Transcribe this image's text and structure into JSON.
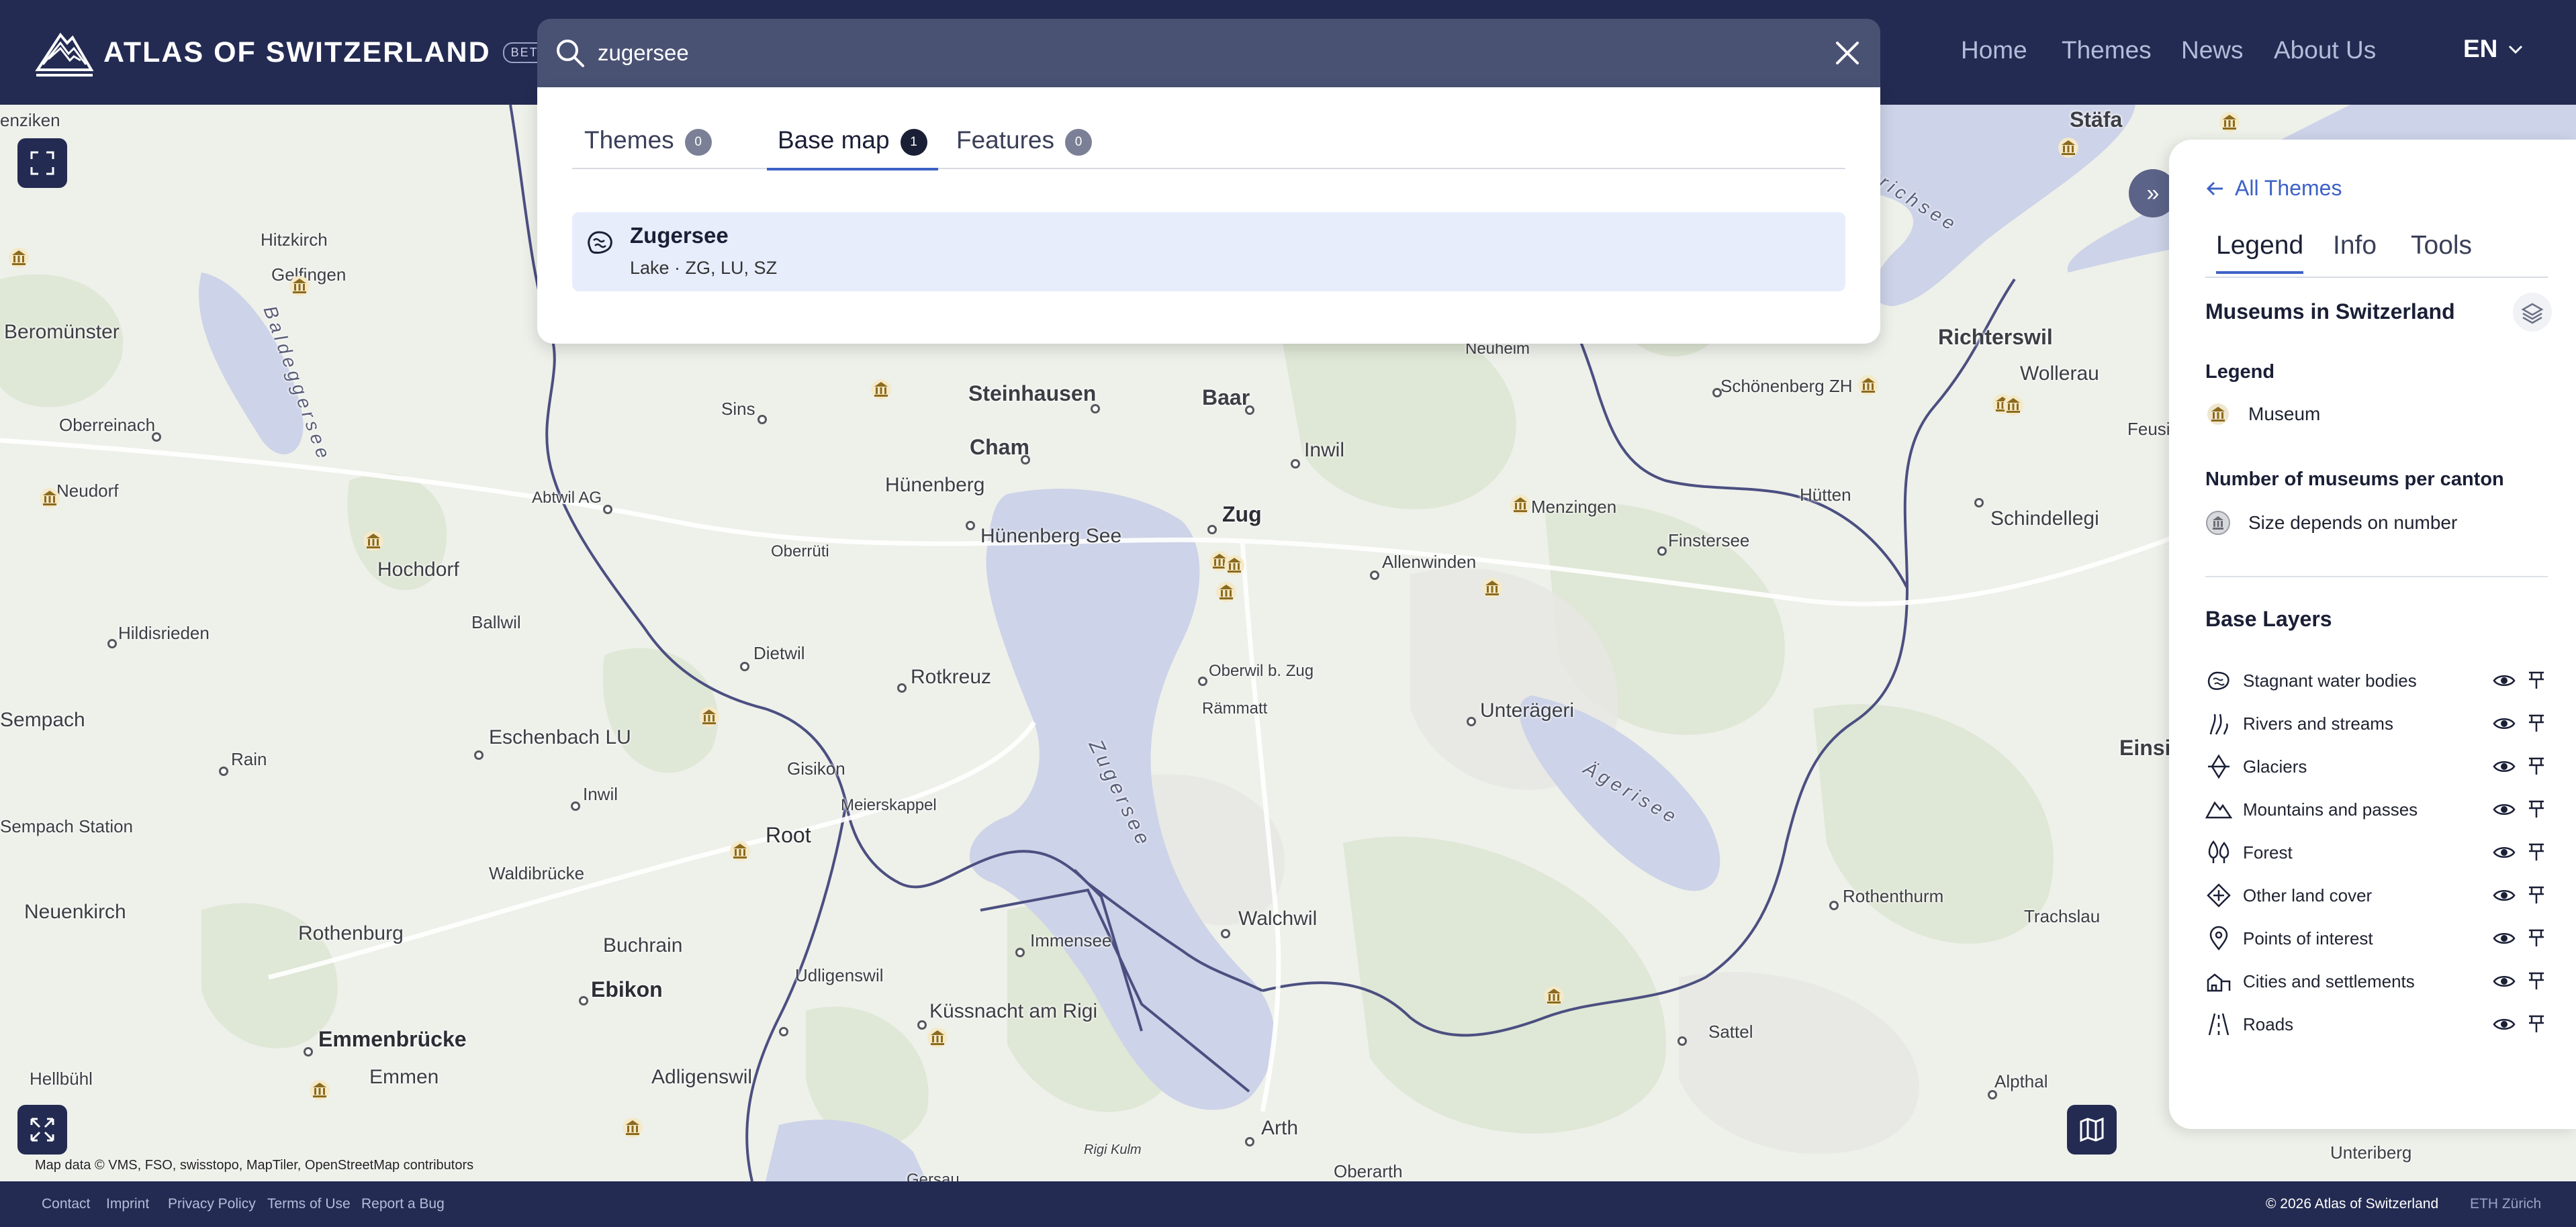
{
  "brand": {
    "name": "ATLAS OF SWITZERLAND",
    "badge": "BETA"
  },
  "search": {
    "value": "zugersee",
    "placeholder": ""
  },
  "nav": {
    "home": "Home",
    "themes": "Themes",
    "news": "News",
    "about": "About Us",
    "lang": "EN"
  },
  "results": {
    "tabs": [
      {
        "label": "Themes",
        "count": "0"
      },
      {
        "label": "Base map",
        "count": "1"
      },
      {
        "label": "Features",
        "count": "0"
      }
    ],
    "active_tab": "Base map",
    "items": [
      {
        "title": "Zugersee",
        "subtitle": "Lake · ZG, LU, SZ"
      }
    ]
  },
  "map": {
    "attribution": "Map data © VMS, FSO, swisstopo, MapTiler, OpenStreetMap contributors",
    "places": [
      "enziken",
      "Hitzkirch",
      "Gelfingen",
      "Beromünster",
      "Baldeggersee",
      "Oberreinach",
      "Neudorf",
      "Hochdorf",
      "Hildisrieden",
      "Ballwil",
      "Sempach",
      "Rain",
      "Sempach Station",
      "Neuenkirch",
      "Rothenburg",
      "Emmenbrücke",
      "Emmen",
      "Hellbühl",
      "Sins",
      "Abtwil AG",
      "Oberrüti",
      "Dietwil",
      "Eschenbach LU",
      "Inwil",
      "Waldibrücke",
      "Buchrain",
      "Ebikon",
      "Adligenswil",
      "Udligenswil",
      "Gisikon",
      "Meierskappel",
      "Root",
      "Rotkreuz",
      "Hünenberg",
      "Hünenberg See",
      "Cham",
      "Steinhausen",
      "Baar",
      "Inwil",
      "Zug",
      "Allenwinden",
      "Oberwil b. Zug",
      "Rämmatt",
      "Zugersee",
      "Immensee",
      "Küssnacht am Rigi",
      "Walchwil",
      "Arth",
      "Rigi Kulm",
      "Oberarth",
      "Unterägeri",
      "Ägerisee",
      "Menzingen",
      "Neuheim",
      "Schönenberg ZH",
      "Hütten",
      "Finstersee",
      "Schindellegi",
      "Rothenthurm",
      "Sattel",
      "Alpthal",
      "Trachslau",
      "Unteriberg",
      "Richterswil",
      "Wollerau",
      "Feusi",
      "Einsi",
      "Stäfa",
      "Zürichsee",
      "Gersau"
    ]
  },
  "panel": {
    "back_label": "All Themes",
    "tabs": [
      "Legend",
      "Info",
      "Tools"
    ],
    "active_tab": "Legend",
    "title": "Museums in Switzerland",
    "legend_heading": "Legend",
    "legend_item": "Museum",
    "count_heading": "Number of museums per canton",
    "count_item": "Size depends on number",
    "base_heading": "Base Layers",
    "layers": [
      {
        "name": "Stagnant water bodies",
        "icon": "water-icon"
      },
      {
        "name": "Rivers and streams",
        "icon": "river-icon"
      },
      {
        "name": "Glaciers",
        "icon": "glacier-icon"
      },
      {
        "name": "Mountains and passes",
        "icon": "mountain-icon"
      },
      {
        "name": "Forest",
        "icon": "forest-icon"
      },
      {
        "name": "Other land cover",
        "icon": "landcover-icon"
      },
      {
        "name": "Points of interest",
        "icon": "poi-icon"
      },
      {
        "name": "Cities and settlements",
        "icon": "city-icon"
      },
      {
        "name": "Roads",
        "icon": "road-icon"
      }
    ]
  },
  "footer": {
    "links": [
      "Contact",
      "Imprint",
      "Privacy Policy",
      "Terms of Use",
      "Report a Bug"
    ],
    "copyright": "© 2026 Atlas of Switzerland",
    "institution": "ETH Zürich"
  },
  "colors": {
    "header": "#232b52",
    "accent": "#3d62c7",
    "lake": "#cdd3e8",
    "border": "#4b4f80"
  }
}
